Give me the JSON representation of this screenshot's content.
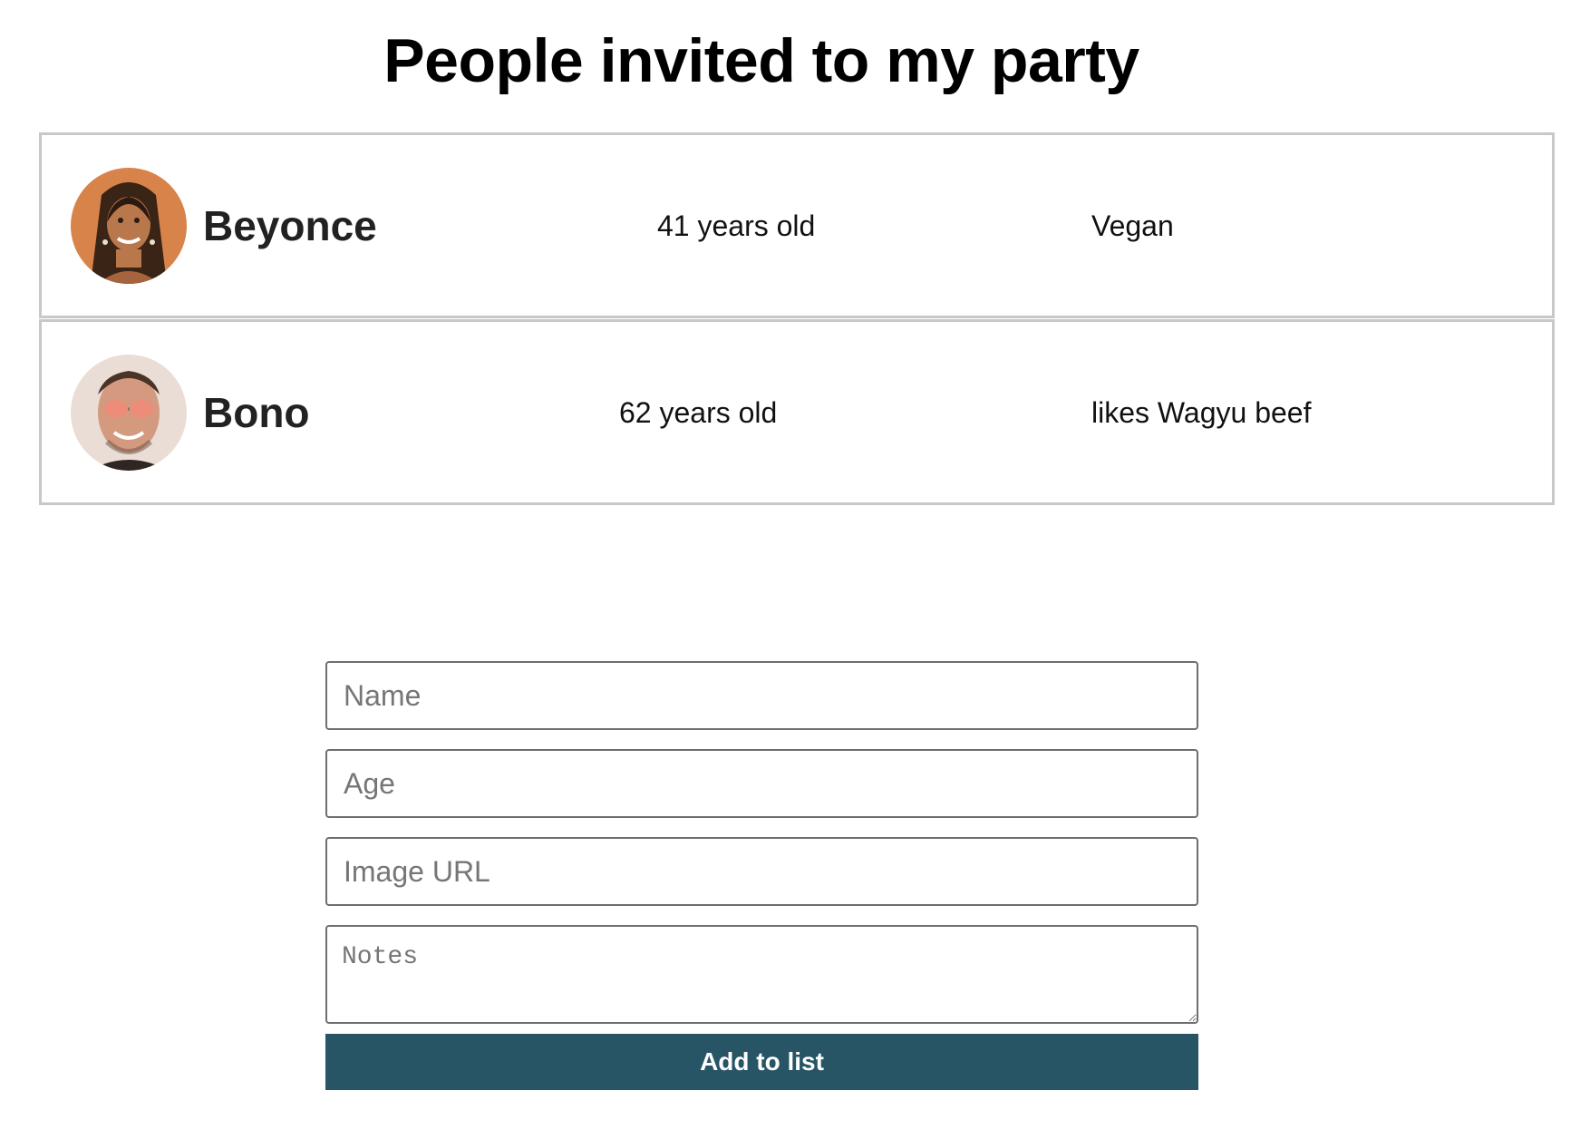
{
  "page": {
    "title": "People invited to my party"
  },
  "guests": [
    {
      "name": "Beyonce",
      "age_text": "41 years old",
      "note": "Vegan",
      "avatar_icon": "avatar-photo-beyonce"
    },
    {
      "name": "Bono",
      "age_text": "62 years old",
      "note": "likes Wagyu beef",
      "avatar_icon": "avatar-photo-bono"
    }
  ],
  "form": {
    "name_placeholder": "Name",
    "age_placeholder": "Age",
    "image_url_placeholder": "Image URL",
    "notes_placeholder": "Notes",
    "submit_label": "Add to list"
  },
  "colors": {
    "button_background": "#285566",
    "button_text": "#ffffff",
    "row_border": "#c8c8c8"
  }
}
